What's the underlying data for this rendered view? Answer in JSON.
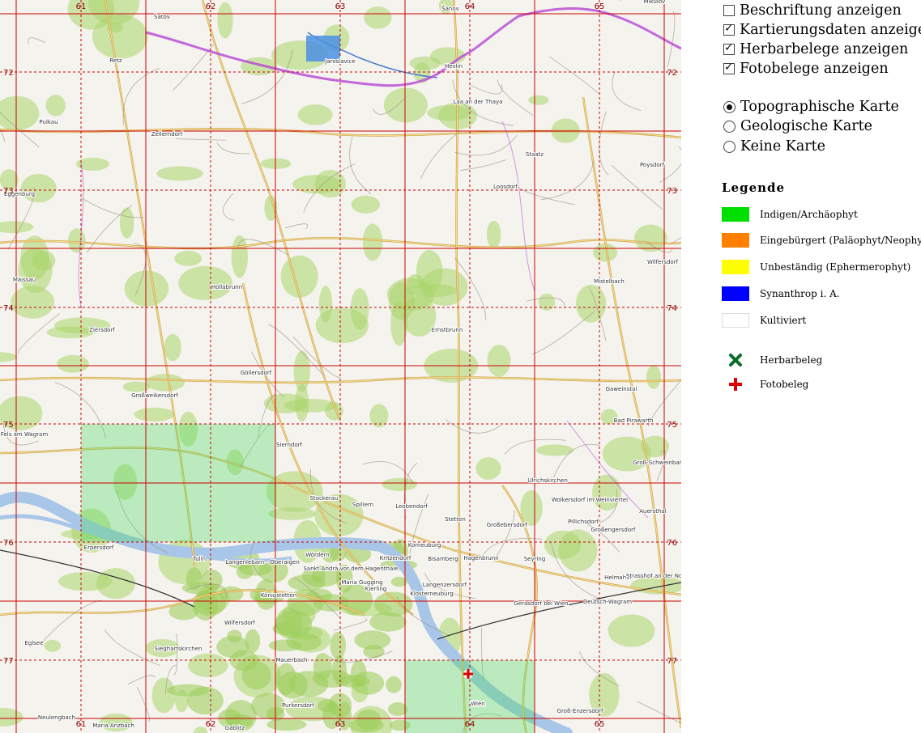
{
  "map": {
    "grid_columns": [
      "61",
      "62",
      "63",
      "64",
      "65"
    ],
    "grid_rows": [
      "72",
      "73",
      "74",
      "75",
      "76",
      "77"
    ],
    "place_labels": [
      "Šatov",
      "Retz",
      "Jaroslavice",
      "Hevlín",
      "Šanov",
      "Mikulov",
      "Laa an der Thaya",
      "Pulkau",
      "Zellerndorf",
      "Staatz",
      "Poysdorf",
      "Eggenburg",
      "Loosdorf",
      "Wilfersdorf",
      "Maissau",
      "Hollabrunn",
      "Mistelbach",
      "Ziersdorf",
      "Ernstbrunn",
      "Göllersdorf",
      "Großweikersdorf",
      "Gaweinstal",
      "Bad Pirawarth",
      "Fels am Wagram",
      "Sierndorf",
      "Groß-Schweinbarth",
      "Stockerau",
      "Spillern",
      "Leobendorf",
      "Ulrichskirchen",
      "Wolkersdorf im Weinviertel",
      "Auersthal",
      "Stetten",
      "Pillichsdorf",
      "Großebersdorf",
      "Großengersdorf",
      "Korneuburg",
      "Seyring",
      "Tulln",
      "Langenlebarn - Oberaigen",
      "Wördern",
      "Kritzendorf",
      "Bisamberg",
      "Hagenbrunn",
      "Sankt Andrä vor dem Hagenthale",
      "Maria Gugging",
      "Kierling",
      "Langenzersdorf",
      "Helmahof",
      "Strasshof an der Nordbahn",
      "Klosterneuburg",
      "Gerasdorf bei Wien",
      "Deutsch-Wagram",
      "Königstetten",
      "Wilfersdorf",
      "Eglsee",
      "Sieghartskirchen",
      "Mauerbach",
      "Wien",
      "Purkersdorf",
      "Groß-Enzersdorf",
      "Neulengbach",
      "Maria Anzbach",
      "Gablitz",
      "Erpersdorf"
    ],
    "colors": {
      "grid": "#cc0000",
      "border": "#b84fd6",
      "river": "#a8c6e8",
      "forest": "#a9d66b",
      "record_cell": "#4cd964"
    }
  },
  "panel": {
    "display_options": [
      {
        "label": "Beschriftung anzeigen",
        "checked": false
      },
      {
        "label": "Kartierungsdaten anzeigen",
        "checked": true
      },
      {
        "label": "Herbarbelege anzeigen",
        "checked": true
      },
      {
        "label": "Fotobelege anzeigen",
        "checked": true
      }
    ],
    "map_types": [
      {
        "label": "Topographische Karte",
        "selected": true
      },
      {
        "label": "Geologische Karte",
        "selected": false
      },
      {
        "label": "Keine Karte",
        "selected": false
      }
    ],
    "legend": {
      "title": "Legende",
      "items": [
        {
          "label": "Indigen/Archäophyt",
          "color": "#00e000"
        },
        {
          "label": "Eingebürgert (Paläophyt/Neophyt)",
          "color": "#ff8000"
        },
        {
          "label": "Unbeständig (Ephermerophyt)",
          "color": "#ffff00"
        },
        {
          "label": "Synanthrop i. A.",
          "color": "#0000ff"
        },
        {
          "label": "Kultiviert",
          "color": "#ffffff"
        }
      ],
      "markers": [
        {
          "label": "Herbarbeleg",
          "icon": "x-marker-icon",
          "color": "#0b6b2e"
        },
        {
          "label": "Fotobeleg",
          "icon": "cross-marker-icon",
          "color": "#e00000"
        }
      ]
    }
  }
}
